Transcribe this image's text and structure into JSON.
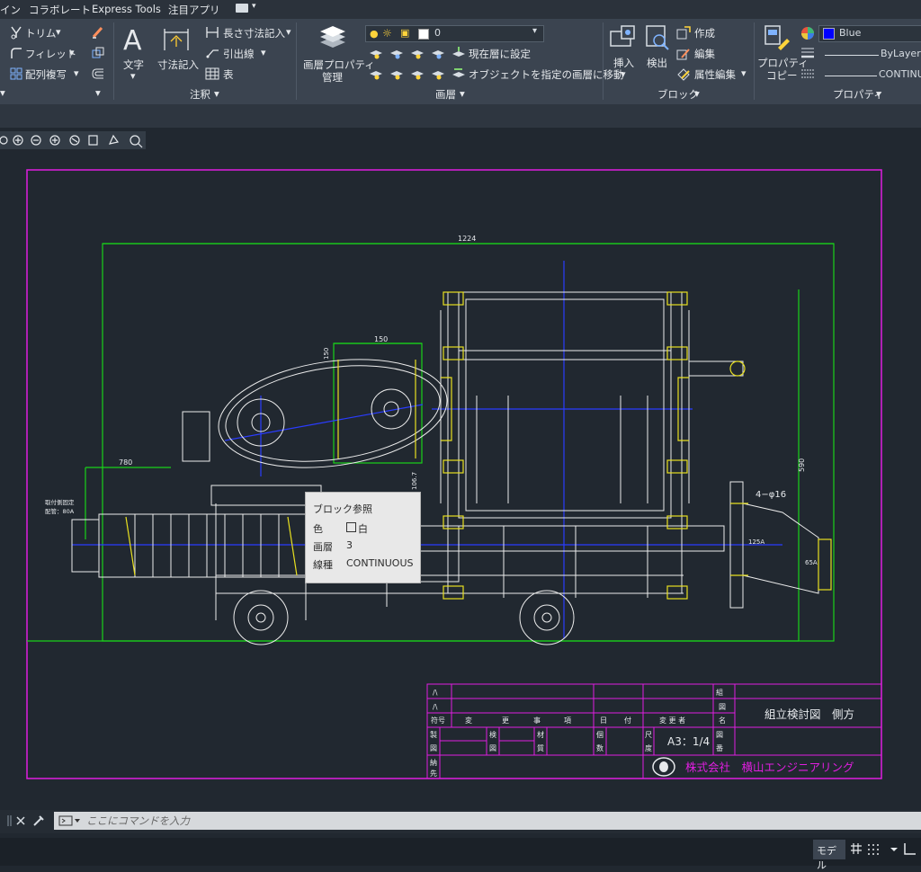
{
  "menu": {
    "items": [
      "イン",
      "コラボレート",
      "Express Tools",
      "注目アプリ"
    ]
  },
  "ribbon": {
    "modify": {
      "trim": "トリム",
      "fillet": "フィレット",
      "array": "配列複写"
    },
    "annotation": {
      "text": "文字",
      "dimension": "寸法記入",
      "linear_dim": "長さ寸法記入",
      "leader": "引出線",
      "table": "表",
      "panel_title": "注釈"
    },
    "layers": {
      "layer_props_line1": "画層プロパティ",
      "layer_props_line2": "管理",
      "current_layer": "0",
      "set_current": "現在層に設定",
      "match_layer": "オブジェクトを指定の画層に移動",
      "panel_title": "画層"
    },
    "block": {
      "insert": "挿入",
      "detect": "検出",
      "create": "作成",
      "edit": "編集",
      "edit_attributes": "属性編集",
      "panel_title": "ブロック"
    },
    "properties": {
      "copy_line1": "プロパティ",
      "copy_line2": "コピー",
      "color": "Blue",
      "color_hex": "#0000ff",
      "lineweight": "ByLayer",
      "linetype": "CONTINUOUS",
      "panel_title": "プロパティ"
    }
  },
  "drawing": {
    "dims": {
      "overall_width": "1224",
      "gear_width": "150",
      "gear_height": "150",
      "left_offset": "780",
      "height_right": "590",
      "height_small": "106.7",
      "holes": "4−φ16",
      "pipe_125": "125A",
      "pipe_65": "65A",
      "pipe_label_1": "取付側固定",
      "pipe_label_2": "配管：80A"
    },
    "title_block": {
      "rev_mark1": "/\\",
      "rev_mark2": "/\\",
      "symbol": "符号",
      "change": "変",
      "more": "更",
      "item": "事",
      "clause": "項",
      "day": "日",
      "date": "付",
      "changer": "変 更 者",
      "design_1": "製",
      "design_2": "図",
      "check_1": "検",
      "check_2": "図",
      "material_1": "材",
      "material_2": "質",
      "qty_1": "個",
      "qty_2": "数",
      "scale_1": "尺",
      "scale_2": "度",
      "scale_value": "A3：1/4",
      "drawing_no_1": "図",
      "drawing_no_2": "番",
      "title_1": "組",
      "title_2": "図",
      "title_3": "名",
      "delivery_1": "納",
      "delivery_2": "先",
      "drawing_name": "組立検討図　側方",
      "company": "株式会社　横山エンジニアリング"
    }
  },
  "tooltip": {
    "title": "ブロック参照",
    "color_label": "色",
    "color_value": "白",
    "layer_label": "画層",
    "layer_value": "3",
    "linetype_label": "線種",
    "linetype_value": "CONTINUOUS"
  },
  "command": {
    "placeholder": "ここにコマンドを入力"
  },
  "status": {
    "model": "モデル"
  }
}
